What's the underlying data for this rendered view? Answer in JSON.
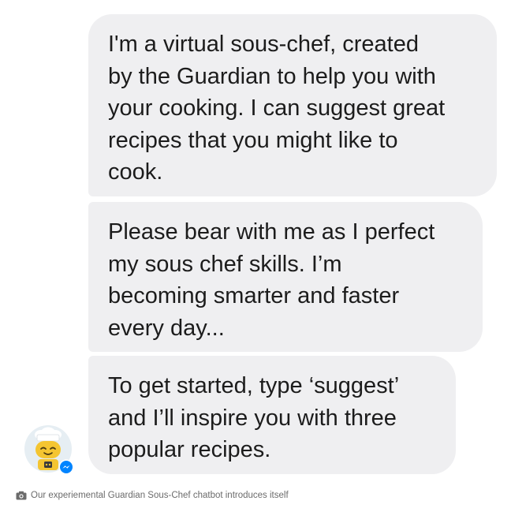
{
  "messages": [
    {
      "text": "I'm a virtual sous-chef, created\nby the Guardian to help you with\nyour cooking. I can suggest great\nrecipes that you might like to\ncook."
    },
    {
      "text": "Please bear with me as I perfect\nmy sous chef skills. I’m\nbecoming smarter and faster\nevery day..."
    },
    {
      "text": "To get started, type ‘suggest’\nand I’ll inspire you with three\npopular recipes."
    }
  ],
  "avatar": {
    "icon": "chef-bot-icon",
    "badge_icon": "messenger-icon",
    "badge_color": "#0084ff"
  },
  "caption": {
    "icon": "camera-icon",
    "text": "Our experiemental Guardian Sous-Chef chatbot introduces itself"
  },
  "colors": {
    "bubble_bg": "#efeff1",
    "bubble_text": "#1c1c1c",
    "caption_text": "#6b6b6b"
  }
}
